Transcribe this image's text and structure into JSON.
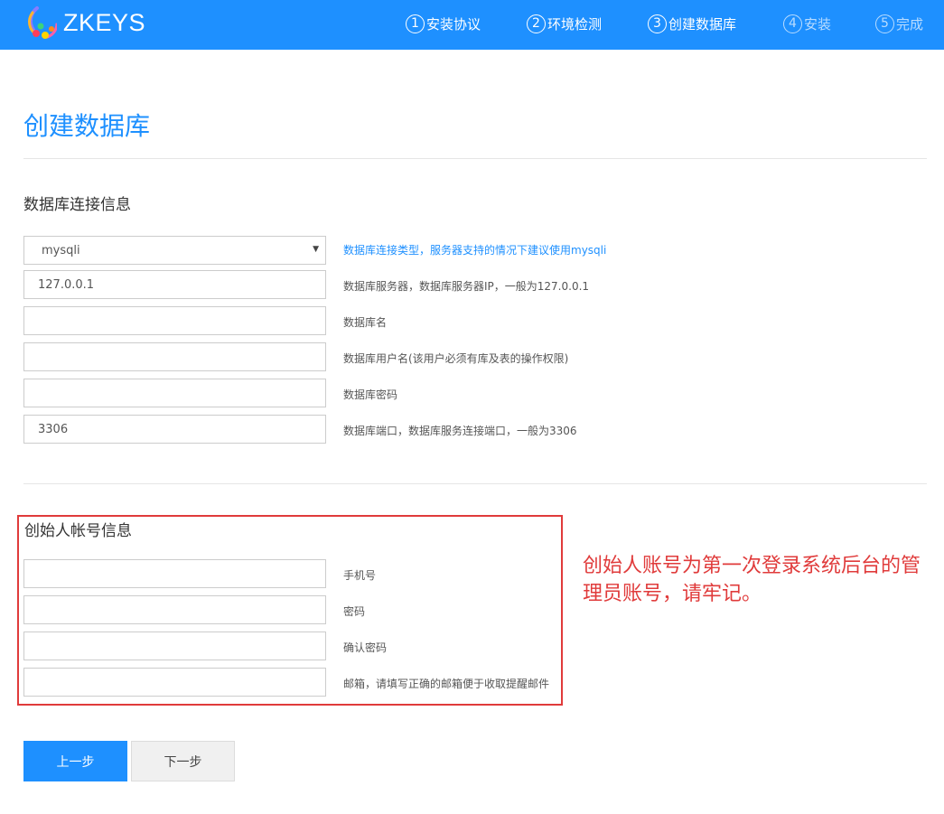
{
  "header": {
    "brand": "ZKEYS",
    "steps": [
      {
        "num": "1",
        "label": "安装协议",
        "active": true
      },
      {
        "num": "2",
        "label": "环境检测",
        "active": true
      },
      {
        "num": "3",
        "label": "创建数据库",
        "active": true
      },
      {
        "num": "4",
        "label": "安装",
        "active": false
      },
      {
        "num": "5",
        "label": "完成",
        "active": false
      }
    ]
  },
  "page": {
    "title": "创建数据库"
  },
  "db_section": {
    "title": "数据库连接信息",
    "fields": [
      {
        "value": "mysqli",
        "hint": "数据库连接类型，服务器支持的情况下建议使用mysqli"
      },
      {
        "value": "127.0.0.1",
        "hint": "数据库服务器，数据库服务器IP，一般为127.0.0.1"
      },
      {
        "value": "",
        "hint": "数据库名"
      },
      {
        "value": "",
        "hint": "数据库用户名(该用户必须有库及表的操作权限)"
      },
      {
        "value": "",
        "hint": "数据库密码"
      },
      {
        "value": "3306",
        "hint": "数据库端口，数据库服务连接端口，一般为3306"
      }
    ]
  },
  "founder_section": {
    "title": "创始人帐号信息",
    "fields": [
      {
        "value": "",
        "hint": "手机号"
      },
      {
        "value": "",
        "hint": "密码"
      },
      {
        "value": "",
        "hint": "确认密码"
      },
      {
        "value": "",
        "hint": "邮箱，请填写正确的邮箱便于收取提醒邮件"
      }
    ]
  },
  "annotation": {
    "text": "创始人账号为第一次登录系统后台的管理员账号，请牢记。"
  },
  "buttons": {
    "prev": "上一步",
    "next": "下一步"
  },
  "colors": {
    "brand_blue": "#1e90ff",
    "annotation_red": "#e03b3b"
  }
}
